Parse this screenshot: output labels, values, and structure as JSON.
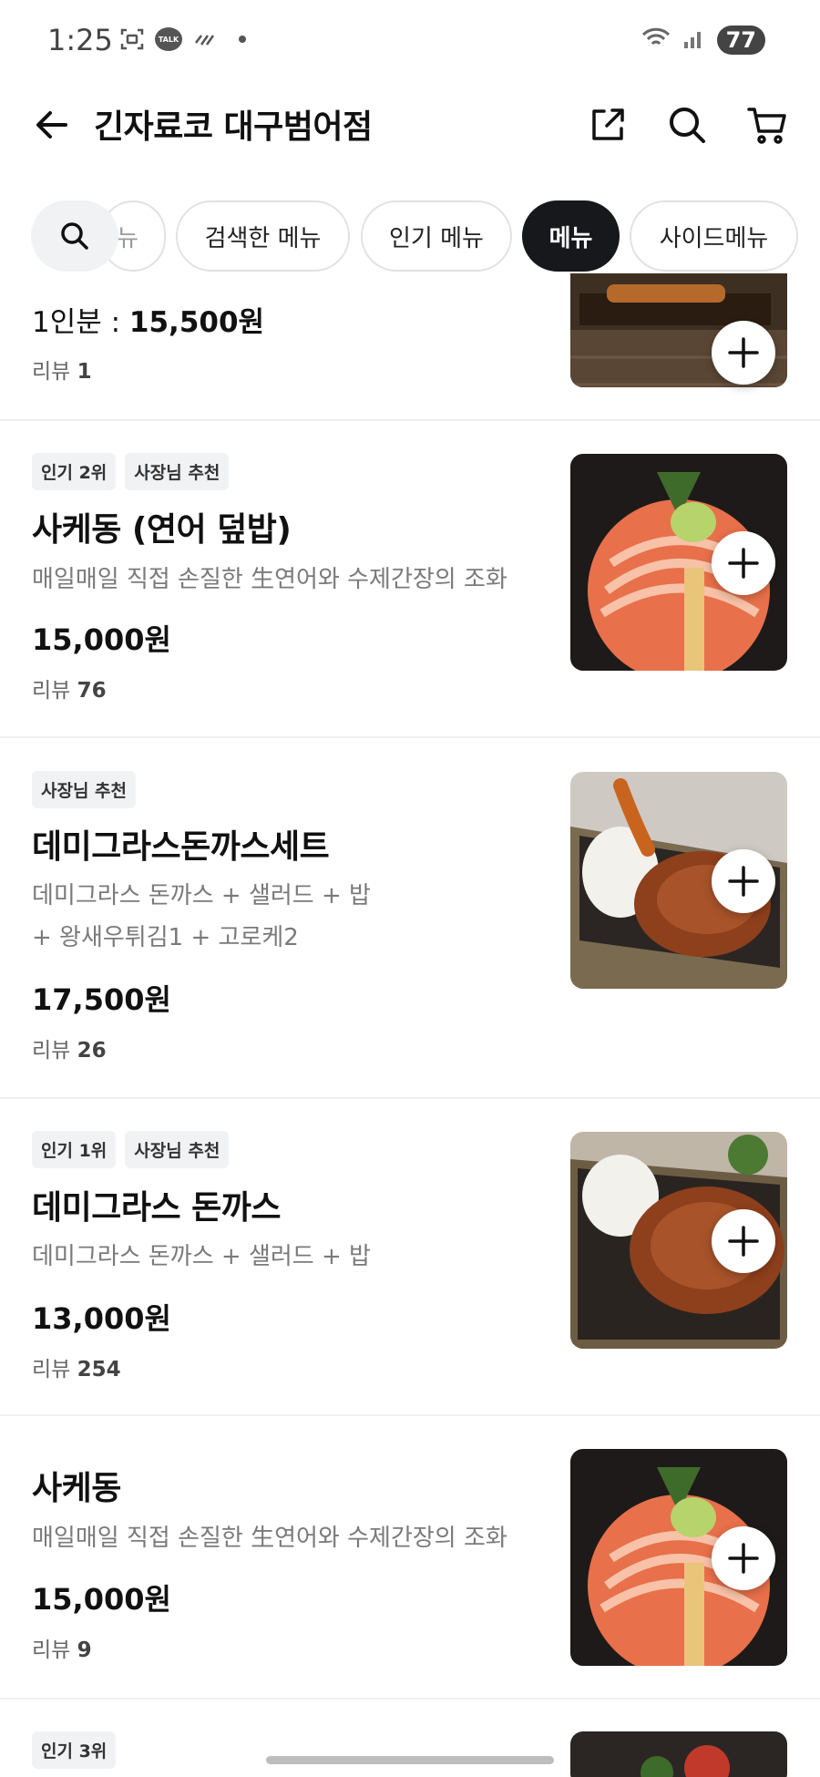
{
  "status_bar": {
    "time": "1:25",
    "battery": "77"
  },
  "header": {
    "title": "긴자료코 대구범어점"
  },
  "tabs": [
    {
      "label": "뉴"
    },
    {
      "label": "검색한 메뉴"
    },
    {
      "label": "인기 메뉴"
    },
    {
      "label": "메뉴"
    },
    {
      "label": "사이드메뉴"
    }
  ],
  "menu_items": [
    {
      "price_label": "1인분 : ",
      "price": "15,500원",
      "review_label": "리뷰 ",
      "review_count": "1"
    },
    {
      "badges": [
        "인기 2위",
        "사장님 추천"
      ],
      "name": "사케동 (연어 덮밥)",
      "desc": "매일매일 직접 손질한 生연어와 수제간장의 조화",
      "price": "15,000원",
      "review_label": "리뷰 ",
      "review_count": "76"
    },
    {
      "badges": [
        "사장님 추천"
      ],
      "name": "데미그라스돈까스세트",
      "desc_line1": "데미그라스 돈까스 + 샐러드 + 밥",
      "desc_line2": "+ 왕새우튀김1 + 고로케2",
      "price": "17,500원",
      "review_label": "리뷰 ",
      "review_count": "26"
    },
    {
      "badges": [
        "인기 1위",
        "사장님 추천"
      ],
      "name": "데미그라스 돈까스",
      "desc": "데미그라스 돈까스 + 샐러드 + 밥",
      "price": "13,000원",
      "review_label": "리뷰 ",
      "review_count": "254"
    },
    {
      "name": "사케동",
      "desc": "매일매일 직접 손질한 生연어와 수제간장의 조화",
      "price": "15,000원",
      "review_label": "리뷰 ",
      "review_count": "9"
    },
    {
      "badges": [
        "인기 3위"
      ]
    }
  ],
  "colors": {
    "active_tab": "#17181b",
    "badge_bg": "#f1f2f4",
    "desc_text": "#7a7a7a"
  }
}
